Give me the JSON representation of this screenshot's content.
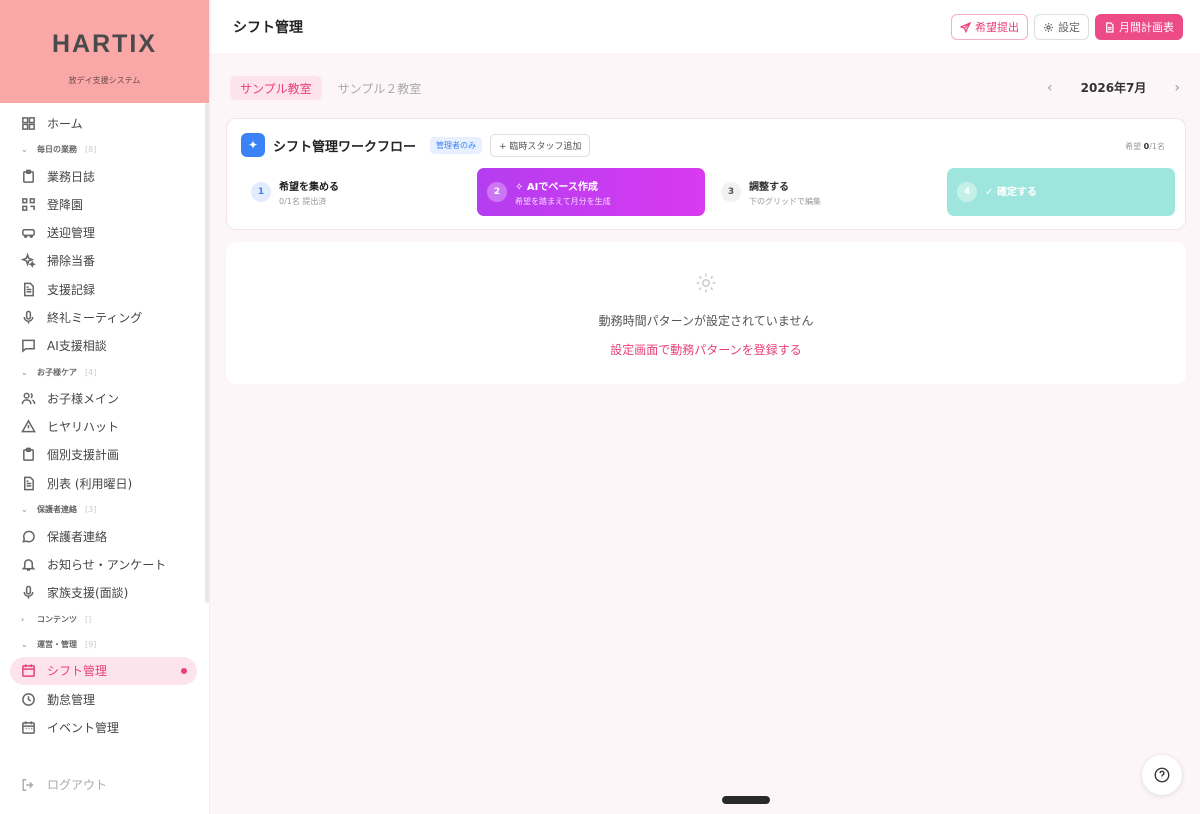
{
  "brand": {
    "name": "HARTIX",
    "subtitle": "放デイ支援システム"
  },
  "sidebar": {
    "home": "ホーム",
    "groups": [
      {
        "label": "毎日の業務",
        "count": "[8]",
        "expanded": true,
        "items": [
          "業務日誌",
          "登降園",
          "送迎管理",
          "掃除当番",
          "支援記録",
          "終礼ミーティング",
          "AI支援相談"
        ]
      },
      {
        "label": "お子様ケア",
        "count": "[4]",
        "expanded": true,
        "items": [
          "お子様メイン",
          "ヒヤリハット",
          "個別支援計画",
          "別表 (利用曜日)"
        ]
      },
      {
        "label": "保護者連絡",
        "count": "[3]",
        "expanded": true,
        "items": [
          "保護者連絡",
          "お知らせ・アンケート",
          "家族支援(面談)"
        ]
      },
      {
        "label": "コンテンツ",
        "count": "[]",
        "expanded": false,
        "items": []
      },
      {
        "label": "運営・管理",
        "count": "[9]",
        "expanded": true,
        "items": [
          "シフト管理",
          "勤怠管理",
          "イベント管理"
        ]
      }
    ],
    "active_item": "シフト管理",
    "logout": "ログアウト"
  },
  "header": {
    "title": "シフト管理",
    "buttons": {
      "hope": "希望提出",
      "settings": "設定",
      "monthly": "月間計画表"
    }
  },
  "classrooms": {
    "tabs": [
      "サンプル教室",
      "サンプル２教室"
    ],
    "active": 0
  },
  "month": {
    "label": "2026年7月",
    "prev": "‹",
    "next": "›"
  },
  "workflow": {
    "title": "シフト管理ワークフロー",
    "admin_badge": "管理者のみ",
    "add_staff": "+ 臨時スタッフ追加",
    "count_prefix": "希望",
    "count_value": "0",
    "count_suffix": "/1名",
    "steps": [
      {
        "num": "1",
        "title": "希望を集める",
        "sub": "0/1名 提出済"
      },
      {
        "num": "2",
        "title": "AIでベース作成",
        "sub": "希望を踏まえて月分を生成"
      },
      {
        "num": "3",
        "title": "調整する",
        "sub": "下のグリッドで編集"
      },
      {
        "num": "4",
        "title": "確定する",
        "sub": ""
      }
    ]
  },
  "empty_state": {
    "message": "動務時間パターンが設定されていません",
    "link": "設定画面で動務パターンを登録する"
  },
  "colors": {
    "accent": "#ec4b86",
    "brand_bg": "#f9a7a7",
    "step_active": "#c53cf0",
    "step_done": "#9ee6dd",
    "badge_blue": "#3b82f6"
  }
}
